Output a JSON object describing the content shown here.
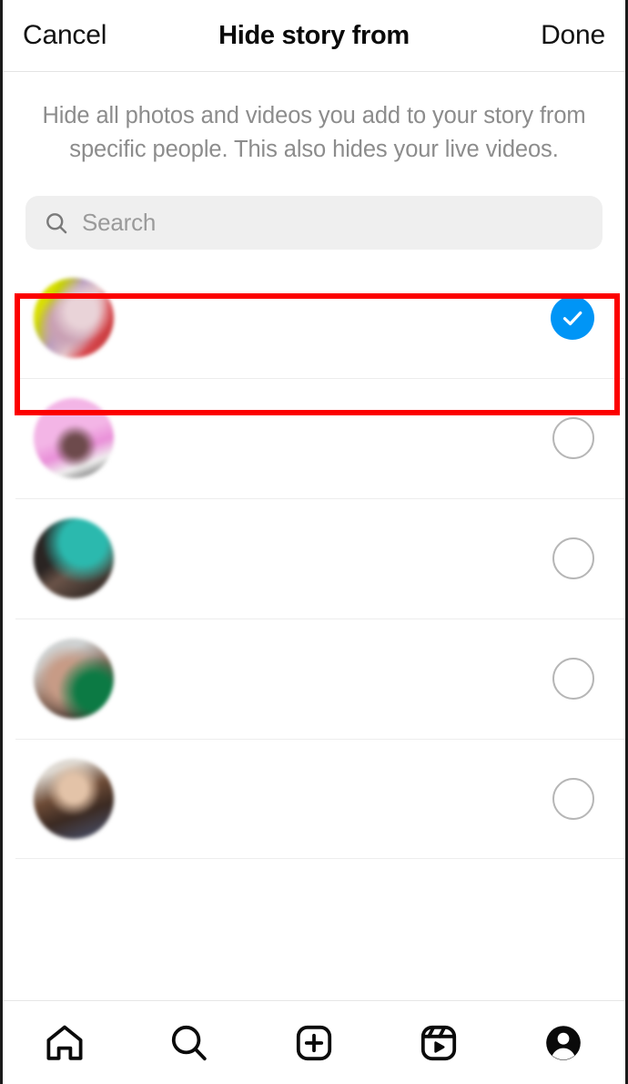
{
  "header": {
    "cancel_label": "Cancel",
    "title": "Hide story from",
    "done_label": "Done"
  },
  "description": "Hide all photos and videos you add to your story from specific people. This also hides your live videos.",
  "search": {
    "placeholder": "Search",
    "value": "",
    "icon": "search-icon",
    "background": "#efefef"
  },
  "colors": {
    "selected_blue": "#0095F6",
    "annotation_red": "#FC0000",
    "divider": "#EDEDED",
    "muted_text": "#8C8C8C"
  },
  "annotation": {
    "shape": "rectangle",
    "color": "#FC0000",
    "target": "first user row"
  },
  "user_list": [
    {
      "username": "",
      "fullname": "",
      "selected": true,
      "selector_icon": "check-circle-filled-icon",
      "avatar": "avatar-1"
    },
    {
      "username": "",
      "fullname": "",
      "selected": false,
      "selector_icon": "circle-outline-icon",
      "avatar": "avatar-2"
    },
    {
      "username": "",
      "fullname": "",
      "selected": false,
      "selector_icon": "circle-outline-icon",
      "avatar": "avatar-3"
    },
    {
      "username": "",
      "fullname": "",
      "selected": false,
      "selector_icon": "circle-outline-icon",
      "avatar": "avatar-4"
    },
    {
      "username": "",
      "fullname": "",
      "selected": false,
      "selector_icon": "circle-outline-icon",
      "avatar": "avatar-5"
    }
  ],
  "tabbar": [
    {
      "name": "home",
      "icon": "home-icon",
      "active": false
    },
    {
      "name": "search",
      "icon": "search-icon",
      "active": false
    },
    {
      "name": "create",
      "icon": "plus-square-icon",
      "active": false
    },
    {
      "name": "reels",
      "icon": "reels-icon",
      "active": false
    },
    {
      "name": "profile",
      "icon": "profile-avatar-icon",
      "active": true
    }
  ]
}
